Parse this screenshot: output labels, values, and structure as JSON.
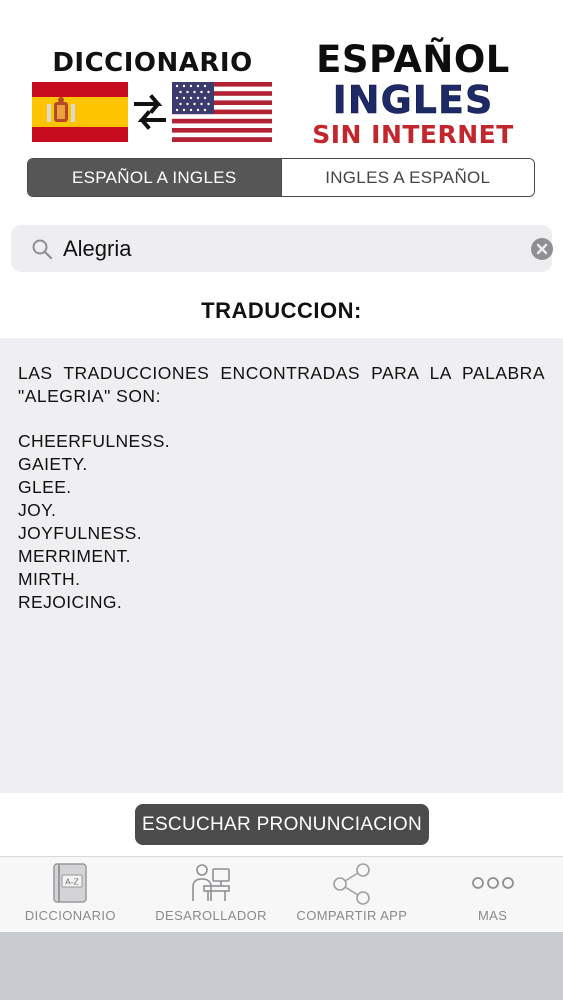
{
  "banner": {
    "dict_title": "DICCIONARIO",
    "title_line1": "ESPAÑOL",
    "title_line2": "INGLES",
    "title_line3": "SIN INTERNET",
    "colors": {
      "navy": "#1e2a66",
      "red": "#c1272d"
    }
  },
  "segmented": {
    "es_to_en": "ESPAÑOL A INGLES",
    "en_to_es": "INGLES A ESPAÑOL",
    "selected": "ESPAÑOL A INGLES"
  },
  "search": {
    "value": "Alegria",
    "icon": "search-icon",
    "clear_icon": "clear-icon"
  },
  "heading": "TRADUCCION:",
  "result": {
    "intro": "LAS TRADUCCIONES ENCONTRADAS PARA LA PALABRA \"ALEGRIA\" SON:",
    "words": [
      "CHEERFULNESS.",
      "GAIETY.",
      "GLEE.",
      "JOY.",
      "JOYFULNESS.",
      "MERRIMENT.",
      "MIRTH.",
      "REJOICING."
    ]
  },
  "listen_button": "ESCUCHAR PRONUNCIACION",
  "tabbar": {
    "items": [
      {
        "label": "DICCIONARIO",
        "icon": "dictionary-book-icon"
      },
      {
        "label": "DESAROLLADOR",
        "icon": "developer-computer-icon"
      },
      {
        "label": "COMPARTIR APP",
        "icon": "share-icon"
      },
      {
        "label": "MAS",
        "icon": "more-dots-icon"
      }
    ]
  }
}
